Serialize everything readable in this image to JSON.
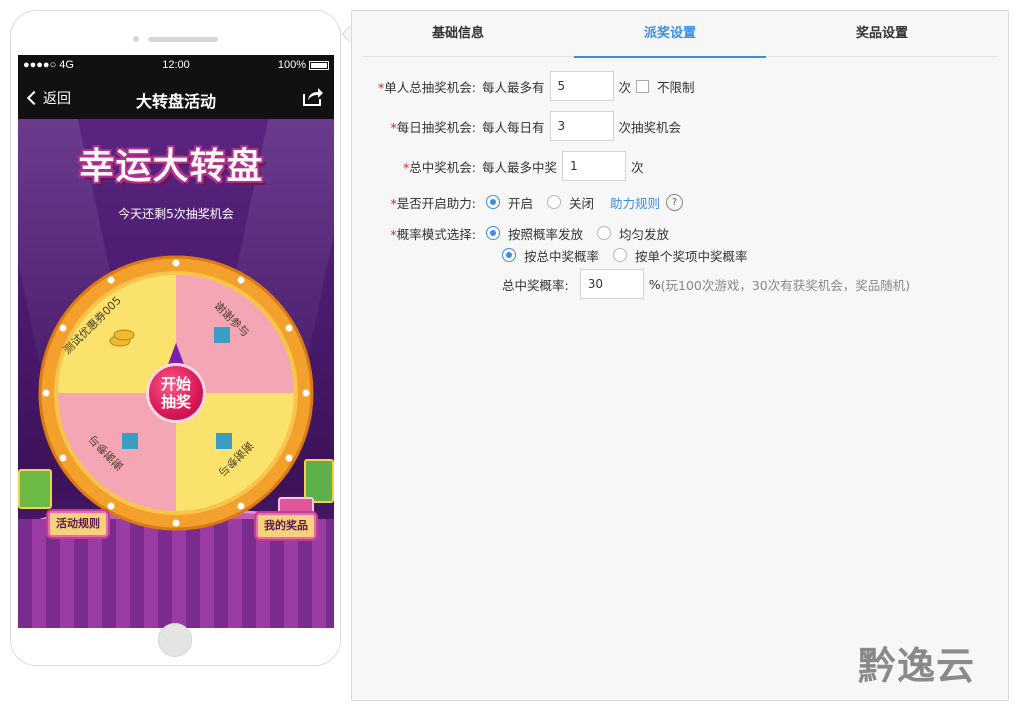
{
  "phone": {
    "status": {
      "signal": "●●●●○ 4G",
      "time": "12:00",
      "battery": "100%"
    },
    "nav": {
      "back": "返回",
      "title": "大转盘活动"
    },
    "game": {
      "logo": "幸运大转盘",
      "chances": "今天还剩5次抽奖机会",
      "prizes": [
        "测试优惠券005",
        "谢谢参与",
        "谢谢参与",
        "谢谢参与"
      ],
      "start": "开始抽奖",
      "rules_button": "活动规则",
      "my_prizes_button": "我的奖品",
      "colors": {
        "segment_yellow": "#fbe26d",
        "segment_pink": "#f5a6b4",
        "rim": "#f3a02c",
        "button": "#d81757"
      }
    }
  },
  "panel": {
    "tabs": [
      "基础信息",
      "派奖设置",
      "奖品设置"
    ],
    "active_tab": "派奖设置",
    "fields": {
      "total_chances": {
        "label": "单人总抽奖机会:",
        "prefix": "每人最多有",
        "value": "5",
        "suffix": "次",
        "checkbox": "不限制"
      },
      "daily_chances": {
        "label": "每日抽奖机会:",
        "prefix": "每人每日有",
        "value": "3",
        "suffix": "次抽奖机会"
      },
      "total_wins": {
        "label": "总中奖机会:",
        "prefix": "每人最多中奖",
        "value": "1",
        "suffix": "次"
      },
      "assist": {
        "label": "是否开启助力:",
        "on": "开启",
        "off": "关闭",
        "rules_link": "助力规则",
        "help": "?"
      },
      "prob_mode": {
        "label": "概率模式选择:",
        "options_a": [
          "按照概率发放",
          "均匀发放"
        ],
        "options_b": [
          "按总中奖概率",
          "按单个奖项中奖概率"
        ]
      },
      "total_prob": {
        "label": "总中奖概率:",
        "value": "30",
        "suffix": "%",
        "note": "(玩100次游戏，30次有获奖机会，奖品随机)"
      }
    },
    "required_mark": "*"
  },
  "brand": {
    "name": "黔逸云"
  },
  "accent_color": "#3a8ee6"
}
